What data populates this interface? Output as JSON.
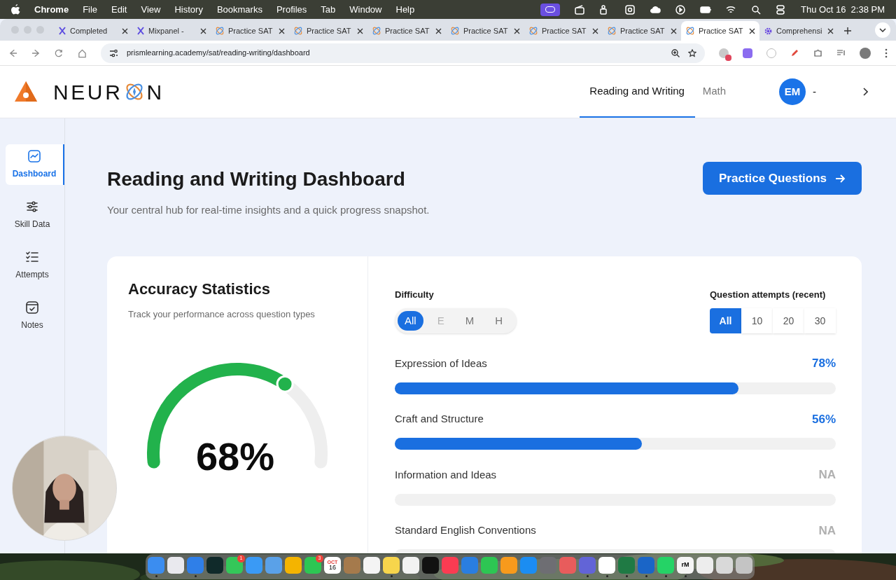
{
  "menubar": {
    "app": "Chrome",
    "menus": [
      "File",
      "Edit",
      "View",
      "History",
      "Bookmarks",
      "Profiles",
      "Tab",
      "Window",
      "Help"
    ],
    "clock": "Thu Oct 16  2:38 PM"
  },
  "tabs": [
    {
      "title": "Completed",
      "kind": "mixpanel",
      "selected": false
    },
    {
      "title": "Mixpanel -",
      "kind": "mixpanel",
      "selected": false
    },
    {
      "title": "Practice SAT",
      "kind": "atom",
      "selected": false
    },
    {
      "title": "Practice SAT",
      "kind": "atom",
      "selected": false
    },
    {
      "title": "Practice SAT",
      "kind": "atom",
      "selected": false
    },
    {
      "title": "Practice SAT",
      "kind": "atom",
      "selected": false
    },
    {
      "title": "Practice SAT",
      "kind": "atom",
      "selected": false
    },
    {
      "title": "Practice SAT",
      "kind": "atom",
      "selected": false
    },
    {
      "title": "Practice SAT",
      "kind": "atom",
      "selected": true
    },
    {
      "title": "Comprehensi",
      "kind": "gear",
      "selected": false
    }
  ],
  "address": "prismlearning.academy/sat/reading-writing/dashboard",
  "header": {
    "brand_left": "NEUR",
    "brand_right": "N",
    "nav": [
      {
        "label": "Reading and Writing",
        "selected": true
      },
      {
        "label": "Math",
        "selected": false
      }
    ],
    "avatar": "EM",
    "user": "-"
  },
  "sidebar": [
    {
      "label": "Dashboard",
      "kind": "chart",
      "selected": true
    },
    {
      "label": "Skill Data",
      "kind": "sliders",
      "selected": false
    },
    {
      "label": "Attempts",
      "kind": "list",
      "selected": false
    },
    {
      "label": "Notes",
      "kind": "note",
      "selected": false
    }
  ],
  "page": {
    "title": "Reading and Writing Dashboard",
    "subtitle": "Your central hub for real-time insights and a quick progress snapshot.",
    "action": "Practice Questions"
  },
  "accuracy": {
    "title": "Accuracy Statistics",
    "subtitle": "Track your performance across question types",
    "value": "68%",
    "level": 0.68
  },
  "difficulty": {
    "label": "Difficulty",
    "options": [
      {
        "label": "All",
        "selected": true,
        "disabled": false
      },
      {
        "label": "E",
        "selected": false,
        "disabled": true
      },
      {
        "label": "M",
        "selected": false,
        "disabled": false
      },
      {
        "label": "H",
        "selected": false,
        "disabled": false
      }
    ]
  },
  "attempts": {
    "label": "Question attempts (recent)",
    "options": [
      {
        "label": "All",
        "selected": true
      },
      {
        "label": "10",
        "selected": false
      },
      {
        "label": "20",
        "selected": false
      },
      {
        "label": "30",
        "selected": false
      }
    ]
  },
  "skills": [
    {
      "name": "Expression of Ideas",
      "value": "78%",
      "kind": "scored",
      "level": 0.78
    },
    {
      "name": "Craft and Structure",
      "value": "56%",
      "kind": "scored",
      "level": 0.56
    },
    {
      "name": "Information and Ideas",
      "value": "NA",
      "kind": "na",
      "level": 0
    },
    {
      "name": "Standard English Conventions",
      "value": "NA",
      "kind": "na",
      "level": 0
    }
  ],
  "dock": [
    {
      "color": "#3b8df0",
      "running": true
    },
    {
      "color": "#e9e9ee",
      "running": false
    },
    {
      "color": "#2f7fe8",
      "running": true
    },
    {
      "color": "#102a2a",
      "running": false
    },
    {
      "color": "#34c759",
      "running": false,
      "badge": "1"
    },
    {
      "color": "#3a9af5",
      "running": false
    },
    {
      "color": "#5aa1e8",
      "running": false
    },
    {
      "color": "#f4b400",
      "running": false
    },
    {
      "color": "#2dc653",
      "running": false,
      "badge": "3"
    },
    {
      "color": "#ffffff",
      "running": false,
      "month": "OCT",
      "day": "16"
    },
    {
      "color": "#a57a4c",
      "running": false
    },
    {
      "color": "#f4f4f4",
      "running": false
    },
    {
      "color": "#f7d54c",
      "running": true
    },
    {
      "color": "#f2f2f2",
      "running": false
    },
    {
      "color": "#111111",
      "running": false
    },
    {
      "color": "#fa3c52",
      "running": false
    },
    {
      "color": "#2a7ee0",
      "running": false
    },
    {
      "color": "#2dc653",
      "running": false
    },
    {
      "color": "#f79a1c",
      "running": false
    },
    {
      "color": "#1b8df2",
      "running": false
    },
    {
      "color": "#6e6e73",
      "running": false
    },
    {
      "color": "#e85c5c",
      "running": false
    },
    {
      "color": "#6264d7",
      "running": true
    },
    {
      "color": "#ffffff",
      "running": true
    },
    {
      "color": "#1f7a44",
      "running": true
    },
    {
      "color": "#1a65c7",
      "running": true
    },
    {
      "color": "#25d366",
      "running": true
    },
    {
      "color": "#f5f5f5",
      "running": true,
      "text": "rM"
    },
    {
      "color": "#ededed",
      "running": false
    },
    {
      "color": "#d9d9d9",
      "running": false
    },
    {
      "color": "#c4c4c4",
      "running": false
    }
  ]
}
